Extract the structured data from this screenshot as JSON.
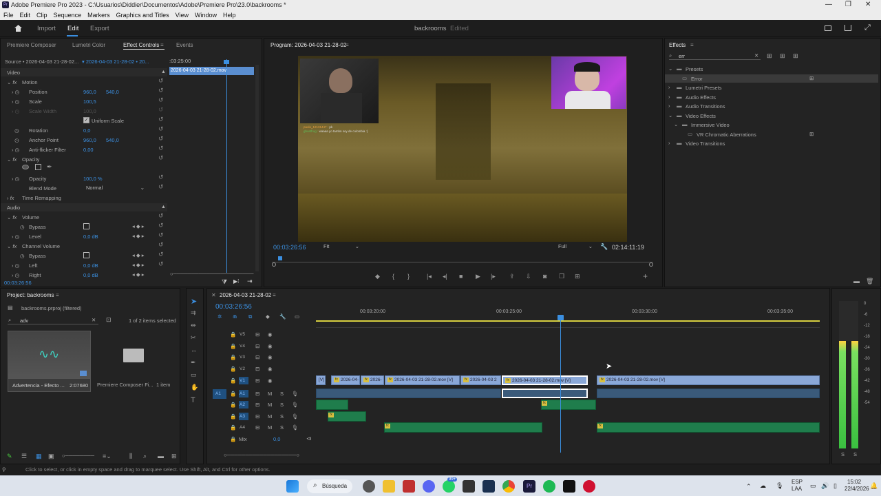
{
  "window": {
    "title": "Adobe Premiere Pro 2023 - C:\\Usuarios\\Diddier\\Documentos\\Adobe\\Premiere Pro\\23.0\\backrooms *",
    "minimize": "—",
    "maximize": "❐",
    "close": "✕"
  },
  "menu": [
    "File",
    "Edit",
    "Clip",
    "Sequence",
    "Markers",
    "Graphics and Titles",
    "View",
    "Window",
    "Help"
  ],
  "header": {
    "import": "Import",
    "edit": "Edit",
    "export": "Export",
    "project_title": "backrooms",
    "edited": "Edited"
  },
  "effect_controls": {
    "tabs": [
      "Premiere Composer",
      "Lumetri Color",
      "Effect Controls",
      "Events"
    ],
    "source": "Source • 2026-04-03 21-28-02...",
    "clip": "2026-04-03 21-28-02 • 20...",
    "timecode_ruler": ":03:25:00",
    "clip_bar": "2026-04-03 21-28-02.mov",
    "video_header": "Video",
    "motion": "Motion",
    "position_label": "Position",
    "position_x": "960,0",
    "position_y": "540,0",
    "scale_label": "Scale",
    "scale_val": "100,5",
    "scale_width_label": "Scale Width",
    "scale_width_val": "100,0",
    "uniform_scale": "Uniform Scale",
    "rotation_label": "Rotation",
    "rotation_val": "0,0",
    "anchor_label": "Anchor Point",
    "anchor_x": "960,0",
    "anchor_y": "540,0",
    "antiflicker_label": "Anti-flicker Filter",
    "antiflicker_val": "0,00",
    "opacity_header": "Opacity",
    "opacity_label": "Opacity",
    "opacity_val": "100,0 %",
    "blend_label": "Blend Mode",
    "blend_val": "Normal",
    "time_remap": "Time Remapping",
    "audio_header": "Audio",
    "volume": "Volume",
    "bypass": "Bypass",
    "level": "Level",
    "level_val": "0,0 dB",
    "channel_volume": "Channel Volume",
    "left": "Left",
    "left_val": "0,0 dB",
    "right": "Right",
    "right_val": "0,0 dB",
    "timecode": "00:03:26:56"
  },
  "program": {
    "title": "Program: 2026-04-03 21-28-02",
    "timecode": "00:03:26:56",
    "fit": "Fit",
    "full": "Full",
    "duration": "02:14:11:19",
    "chat1_user": "paolo_12131447 :",
    "chat1_msg": "pk",
    "chat2_user": "ghostfrog :",
    "chat2_msg": "waaaa yo tambn soy de colombia :)"
  },
  "effects": {
    "title": "Effects",
    "search": "err",
    "items": [
      {
        "label": "Presets",
        "indent": 0,
        "expanded": true
      },
      {
        "label": "Error",
        "indent": 1,
        "expanded": false
      },
      {
        "label": "Lumetri Presets",
        "indent": 0,
        "expanded": false
      },
      {
        "label": "Audio Effects",
        "indent": 0,
        "expanded": false
      },
      {
        "label": "Audio Transitions",
        "indent": 0,
        "expanded": false
      },
      {
        "label": "Video Effects",
        "indent": 0,
        "expanded": true
      },
      {
        "label": "Immersive Video",
        "indent": 1,
        "expanded": true
      },
      {
        "label": "VR Chromatic Aberrations",
        "indent": 2,
        "expanded": false
      },
      {
        "label": "Video Transitions",
        "indent": 0,
        "expanded": false
      }
    ]
  },
  "project": {
    "title": "Project: backrooms",
    "file": "backrooms.prproj (filtered)",
    "search": "adv",
    "selected": "1 of 2 items selected",
    "item1_name": "Advertencia - Efecto ...",
    "item1_dur": "2:07680",
    "item2_name": "Premiere Composer Fi...",
    "item2_count": "1 item"
  },
  "timeline": {
    "title": "2026-04-03 21-28-02",
    "timecode": "00:03:26:56",
    "ticks": [
      "00:03:20:00",
      "00:03:25:00",
      "00:03:30:00",
      "00:03:35:00"
    ],
    "tracks_v": [
      "V5",
      "V4",
      "V3",
      "V2",
      "V1"
    ],
    "tracks_a": [
      "A1",
      "A2",
      "A3",
      "A4"
    ],
    "mix": "Mix",
    "mix_val": "0,0",
    "clips_v": [
      "[V]",
      "2026-04-",
      "2026-",
      "2026-04-03 21-28-02.mov [V]",
      "2026-04-03 2",
      "2026-04-03 21-28-02.mov [V]",
      "2026-04-03 21-28-02.mov [V]"
    ]
  },
  "meter": {
    "labels": [
      "0",
      "-6",
      "-12",
      "-18",
      "-24",
      "-30",
      "-36",
      "-42",
      "-48",
      "-54"
    ],
    "s1": "S",
    "s2": "S"
  },
  "status": {
    "text": "Click to select, or click in empty space and drag to marquee select. Use Shift, Alt, and Ctrl for other options."
  },
  "taskbar": {
    "search": "Búsqueda",
    "lang1": "ESP",
    "lang2": "LAA",
    "time": "15:02",
    "date": "22/4/2026",
    "badge": "99+"
  }
}
